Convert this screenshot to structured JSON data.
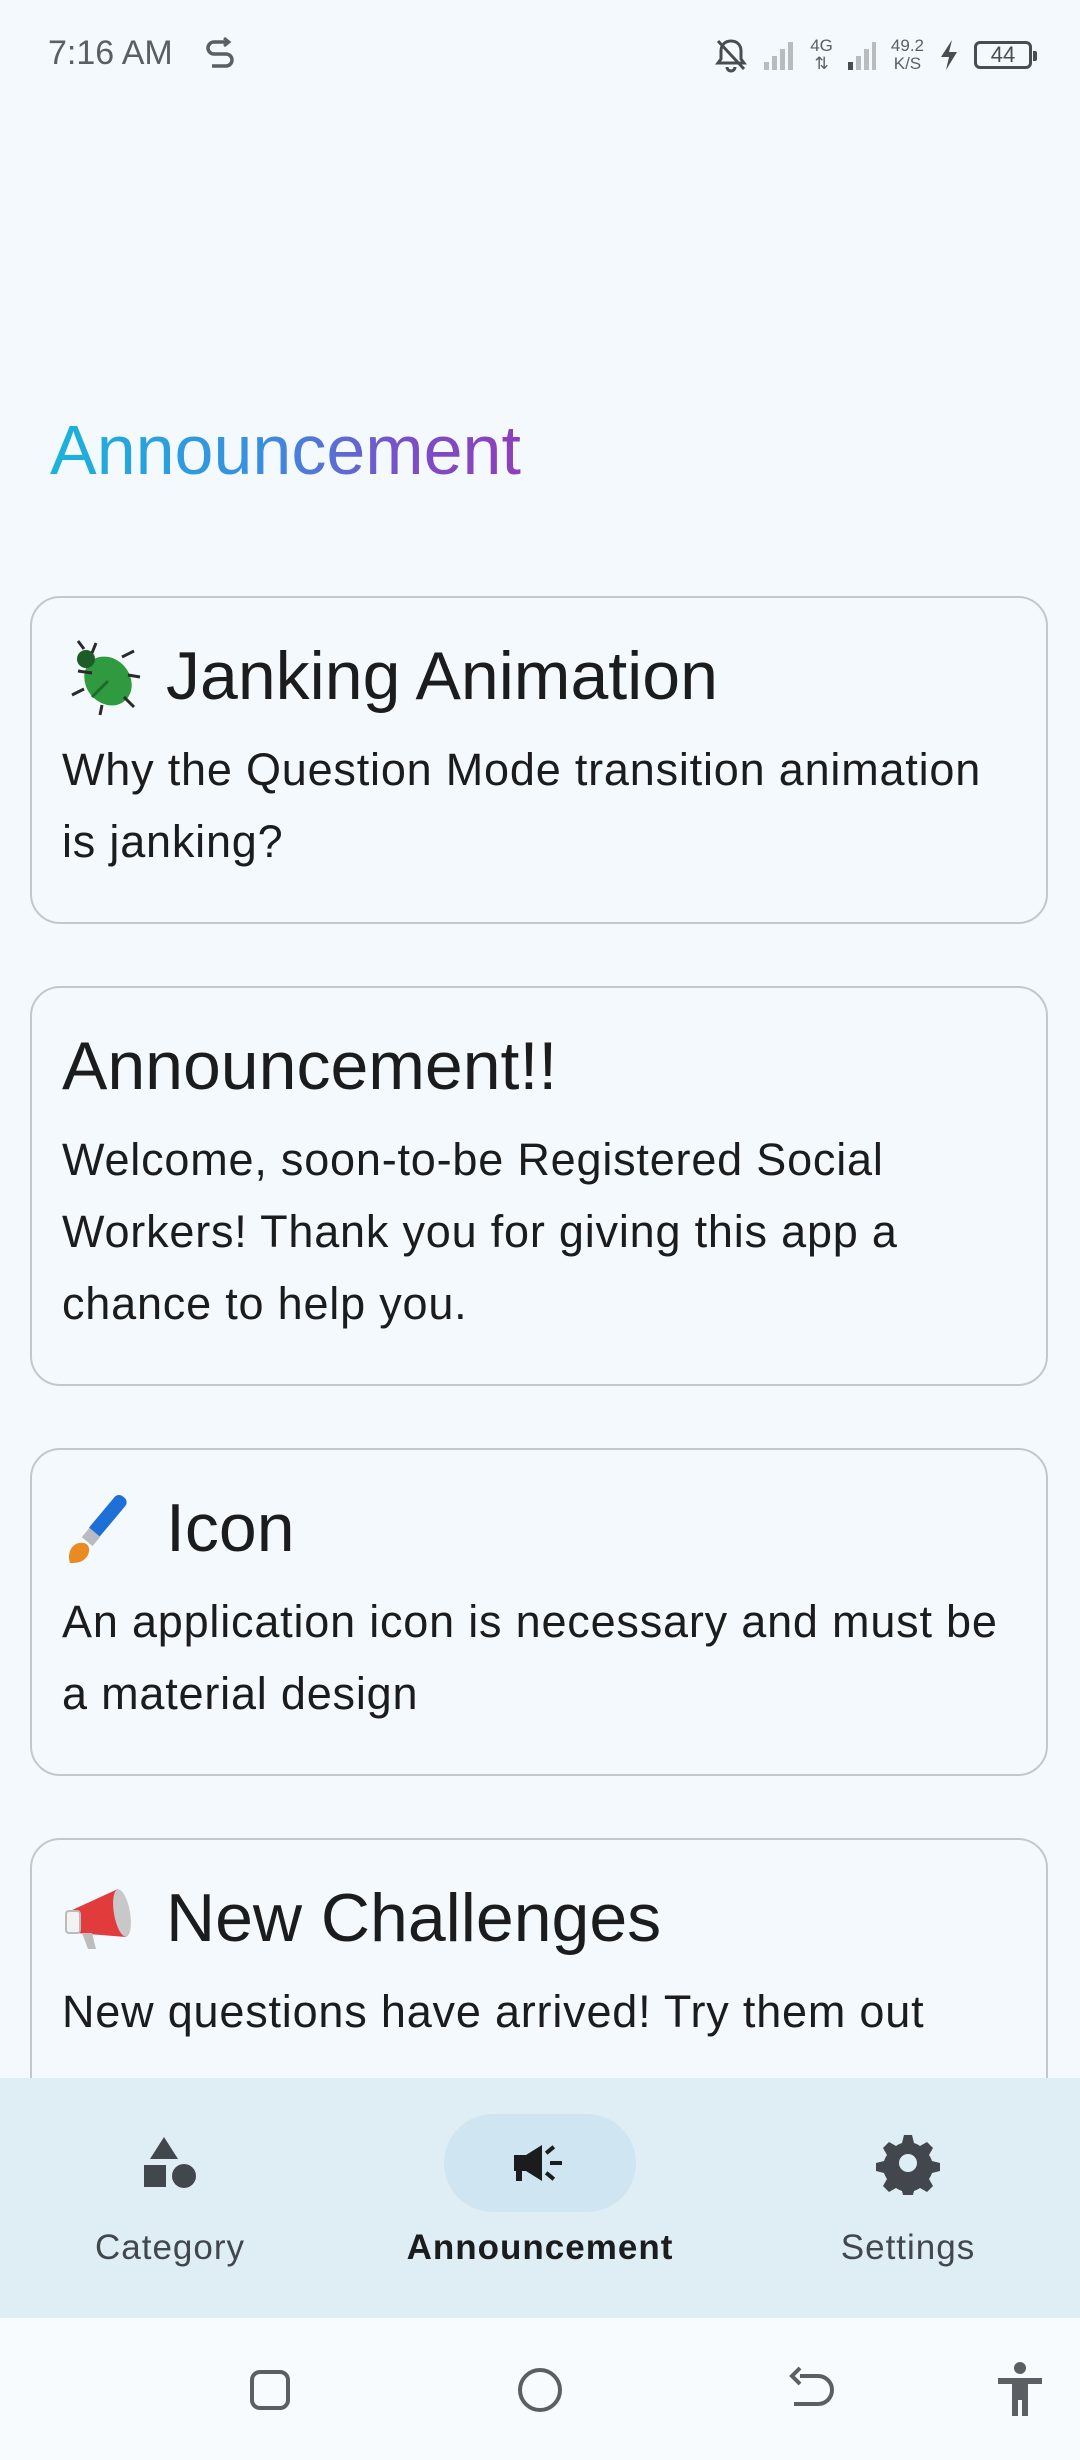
{
  "status_bar": {
    "time": "7:16 AM",
    "network": "4G",
    "speed_value": "49.2",
    "speed_unit": "K/S",
    "battery": "44"
  },
  "page": {
    "title": "Announcement"
  },
  "announcements": [
    {
      "emoji": "beetle-icon",
      "title": "Janking Animation",
      "body": "Why the Question Mode transition animation is janking?"
    },
    {
      "emoji": "",
      "title": "Announcement!!",
      "body": "Welcome, soon-to-be Registered Social Workers! Thank you for giving this app a chance to help you."
    },
    {
      "emoji": "paintbrush-icon",
      "title": "Icon",
      "body": "An application icon is necessary and must be a material design"
    },
    {
      "emoji": "megaphone-icon",
      "title": "New Challenges",
      "body": "New questions have arrived! Try them out"
    }
  ],
  "bottom_nav": {
    "items": [
      {
        "label": "Category",
        "icon": "shapes-icon",
        "active": false
      },
      {
        "label": "Announcement",
        "icon": "campaign-icon",
        "active": true
      },
      {
        "label": "Settings",
        "icon": "gear-icon",
        "active": false
      }
    ]
  },
  "colors": {
    "background": "#f3f9fd",
    "nav_background": "#dfedf4",
    "active_pill": "#cfe5f1",
    "title_gradient_start": "#1bb3d9",
    "title_gradient_end": "#8e3fb8"
  }
}
